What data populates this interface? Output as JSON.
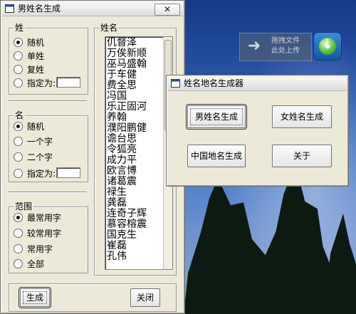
{
  "desktop": {
    "drop_zone_text": [
      "拖拽文件",
      "此处上传"
    ],
    "download_icon": "download-arrow-icon"
  },
  "main_window": {
    "title": "男姓名生成",
    "close_symbol": "✕",
    "surname_group": {
      "label": "姓",
      "options": [
        "随机",
        "单姓",
        "复姓",
        "指定为:"
      ],
      "selected": 0,
      "specified_value": ""
    },
    "given_name_group": {
      "label": "名",
      "options": [
        "随机",
        "一个字",
        "二个字",
        "指定为:"
      ],
      "selected": 0,
      "specified_value": ""
    },
    "range_group": {
      "label": "范围",
      "options": [
        "最常用字",
        "较常用字",
        "常用字",
        "全部"
      ],
      "selected": 0
    },
    "names_group": {
      "label": "姓名",
      "names": [
        "仉督泽",
        "万俟新顺",
        "巫马盛翰",
        "于车健",
        "费全思",
        "冯国",
        "乐正固河",
        "养翰",
        "濮阳鹏健",
        "谵台思",
        "令狐亮",
        "成力平",
        "欧言博",
        "诸葛震",
        "禄生",
        "龚磊",
        "连奇子辉",
        "慕容榕震",
        "国克生",
        "崔磊",
        "孔伟"
      ]
    },
    "generate_button": "生成",
    "close_button": "关闭"
  },
  "launcher_window": {
    "title": "姓名地名生成器",
    "buttons": [
      "男姓名生成",
      "女姓名生成",
      "中国地名生成",
      "关于"
    ]
  },
  "colors": {
    "window_face": "#ece9d8",
    "desktop_sky": "#2a57ad"
  }
}
